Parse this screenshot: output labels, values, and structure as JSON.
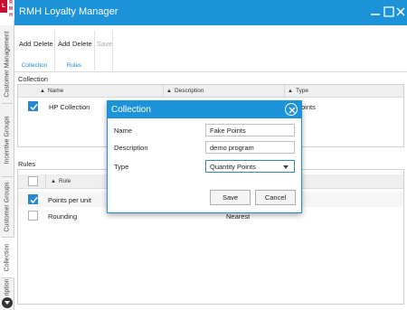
{
  "app": {
    "title": "RMH Loyalty Manager",
    "logo_letters": [
      "L",
      "R",
      "M",
      "H"
    ]
  },
  "sidebar": {
    "tabs": [
      {
        "label": "Customer Management"
      },
      {
        "label": "Incentive Groups"
      },
      {
        "label": "Customer Groups"
      },
      {
        "label": "Collection"
      },
      {
        "label": "ription"
      }
    ]
  },
  "ribbon": {
    "collection_group": {
      "add": "Add",
      "delete": "Delete",
      "label": "Collection"
    },
    "rules_group": {
      "add": "Add",
      "delete": "Delete",
      "label": "Rules"
    },
    "save": "Save"
  },
  "collection": {
    "section_title": "Collection",
    "columns": [
      "Name",
      "Description",
      "Type"
    ],
    "rows": [
      {
        "name": "HP Collection",
        "type_partial": "oints",
        "checked": true
      }
    ]
  },
  "rules": {
    "section_title": "Rules",
    "columns": [
      "Rule"
    ],
    "rows": [
      {
        "rule": "Points per unit",
        "value": "",
        "checked": true
      },
      {
        "rule": "Rounding",
        "value": "Nearest",
        "checked": false
      }
    ]
  },
  "dialog": {
    "title": "Collection",
    "fields": {
      "name_label": "Name",
      "name_value": "Fake Points",
      "description_label": "Description",
      "description_value": "demo program",
      "type_label": "Type",
      "type_value": "Quantity Points"
    },
    "save": "Save",
    "cancel": "Cancel"
  },
  "colors": {
    "accent": "#1c93d9",
    "check": "#2a88d0"
  }
}
